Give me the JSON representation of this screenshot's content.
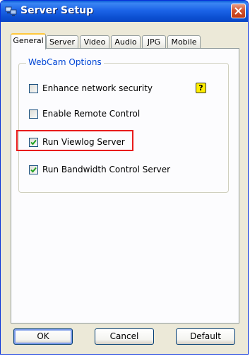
{
  "window": {
    "title": "Server Setup",
    "title_icon": "computers-icon",
    "close_icon": "close-icon"
  },
  "tabs": [
    {
      "label": "General",
      "active": true
    },
    {
      "label": "Server"
    },
    {
      "label": "Video"
    },
    {
      "label": "Audio"
    },
    {
      "label": "JPG"
    },
    {
      "label": "Mobile"
    }
  ],
  "group": {
    "label": "WebCam Options"
  },
  "options": [
    {
      "label": "Enhance network security",
      "checked": false
    },
    {
      "label": "Enable Remote Control",
      "checked": false
    },
    {
      "label": "Run Viewlog Server",
      "checked": true
    },
    {
      "label": "Run Bandwidth Control Server",
      "checked": true
    }
  ],
  "help_icon": {
    "glyph": "?"
  },
  "buttons": {
    "ok": "OK",
    "cancel": "Cancel",
    "default": "Default"
  },
  "colors": {
    "highlight": "#e81b1b",
    "group_label": "#0046d5",
    "titlebar": "#0b4fd1"
  }
}
